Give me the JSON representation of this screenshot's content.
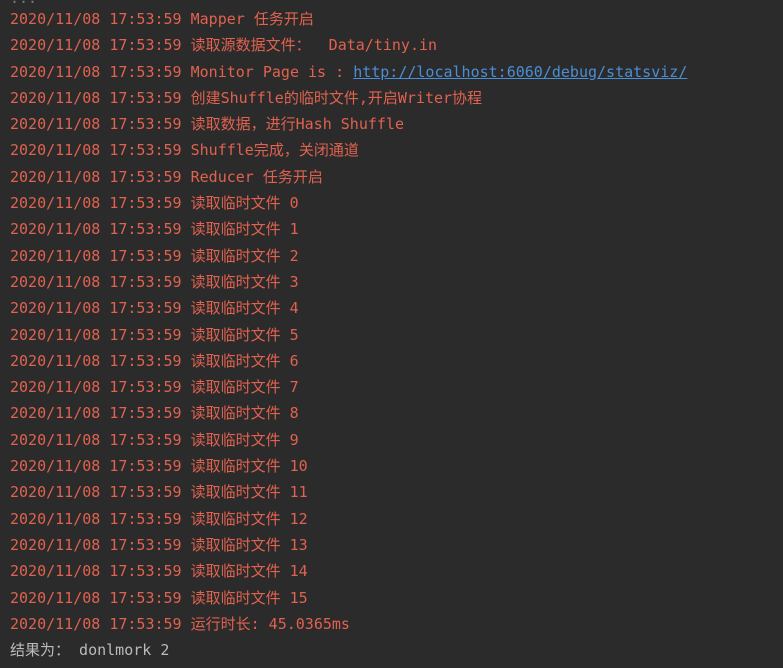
{
  "console": {
    "top_fragment": "...",
    "lines": [
      {
        "ts": "2020/11/08 17:53:59",
        "msg": "Mapper 任务开启"
      },
      {
        "ts": "2020/11/08 17:53:59",
        "msg": "读取源数据文件：  Data/tiny.in"
      },
      {
        "ts": "2020/11/08 17:53:59",
        "msg": "Monitor Page is : ",
        "link": "http://localhost:6060/debug/statsviz/"
      },
      {
        "ts": "2020/11/08 17:53:59",
        "msg": "创建Shuffle的临时文件,开启Writer协程"
      },
      {
        "ts": "2020/11/08 17:53:59",
        "msg": "读取数据，进行Hash Shuffle"
      },
      {
        "ts": "2020/11/08 17:53:59",
        "msg": "Shuffle完成，关闭通道"
      },
      {
        "ts": "2020/11/08 17:53:59",
        "msg": "Reducer 任务开启"
      },
      {
        "ts": "2020/11/08 17:53:59",
        "msg": "读取临时文件 0"
      },
      {
        "ts": "2020/11/08 17:53:59",
        "msg": "读取临时文件 1"
      },
      {
        "ts": "2020/11/08 17:53:59",
        "msg": "读取临时文件 2"
      },
      {
        "ts": "2020/11/08 17:53:59",
        "msg": "读取临时文件 3"
      },
      {
        "ts": "2020/11/08 17:53:59",
        "msg": "读取临时文件 4"
      },
      {
        "ts": "2020/11/08 17:53:59",
        "msg": "读取临时文件 5"
      },
      {
        "ts": "2020/11/08 17:53:59",
        "msg": "读取临时文件 6"
      },
      {
        "ts": "2020/11/08 17:53:59",
        "msg": "读取临时文件 7"
      },
      {
        "ts": "2020/11/08 17:53:59",
        "msg": "读取临时文件 8"
      },
      {
        "ts": "2020/11/08 17:53:59",
        "msg": "读取临时文件 9"
      },
      {
        "ts": "2020/11/08 17:53:59",
        "msg": "读取临时文件 10"
      },
      {
        "ts": "2020/11/08 17:53:59",
        "msg": "读取临时文件 11"
      },
      {
        "ts": "2020/11/08 17:53:59",
        "msg": "读取临时文件 12"
      },
      {
        "ts": "2020/11/08 17:53:59",
        "msg": "读取临时文件 13"
      },
      {
        "ts": "2020/11/08 17:53:59",
        "msg": "读取临时文件 14"
      },
      {
        "ts": "2020/11/08 17:53:59",
        "msg": "读取临时文件 15"
      },
      {
        "ts": "2020/11/08 17:53:59",
        "msg": "运行时长: 45.0365ms"
      }
    ],
    "result": {
      "label": "结果为：",
      "value": " donlmork 2"
    }
  },
  "colors": {
    "background": "#2b2b2b",
    "log_text": "#e0624f",
    "link": "#4a8fd6",
    "plain_text": "#bbbbbb"
  }
}
